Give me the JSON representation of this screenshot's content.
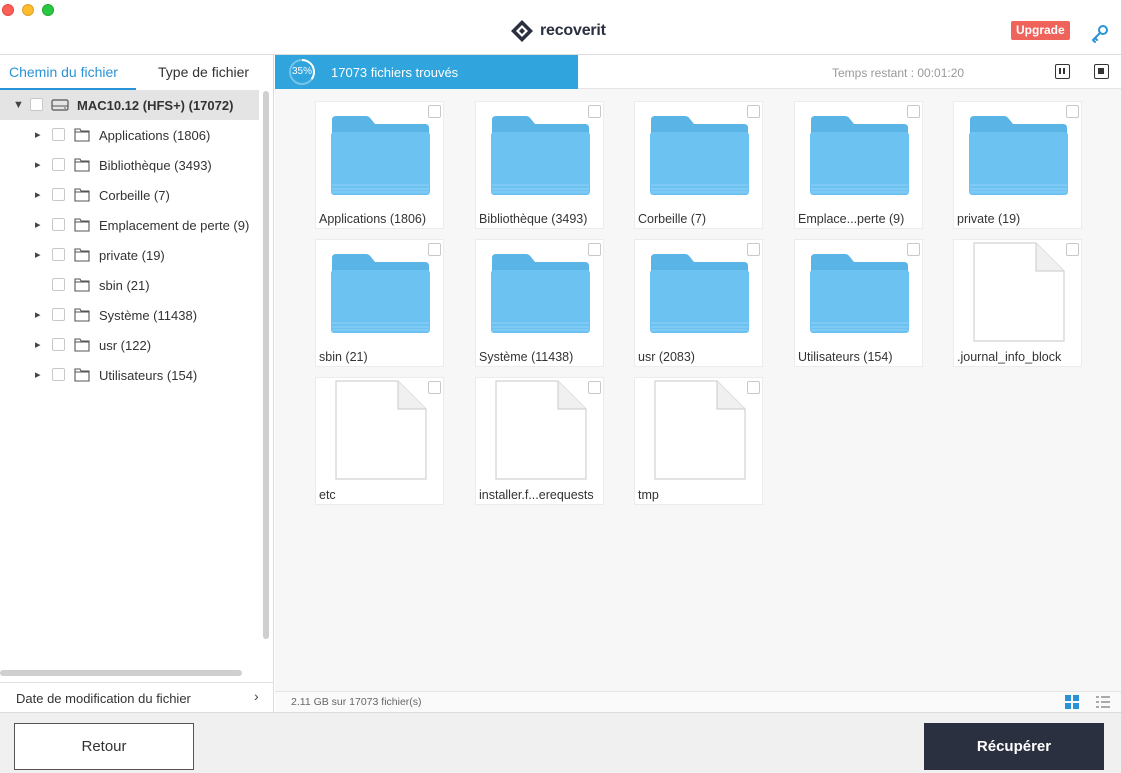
{
  "app": {
    "name_part1": "recover",
    "name_part2": "it",
    "upgrade_label": "Upgrade"
  },
  "sidebar": {
    "tabs": [
      {
        "label": "Chemin du fichier",
        "active": true
      },
      {
        "label": "Type de fichier",
        "active": false
      }
    ],
    "root": {
      "label": "MAC10.12 (HFS+) (17072)",
      "expanded": true
    },
    "items": [
      {
        "label": "Applications (1806)",
        "expandable": true
      },
      {
        "label": "Bibliothèque (3493)",
        "expandable": true
      },
      {
        "label": "Corbeille (7)",
        "expandable": true
      },
      {
        "label": "Emplacement de perte (9)",
        "expandable": true
      },
      {
        "label": "private (19)",
        "expandable": true
      },
      {
        "label": "sbin (21)",
        "expandable": false
      },
      {
        "label": "Système (11438)",
        "expandable": true
      },
      {
        "label": "usr (122)",
        "expandable": true
      },
      {
        "label": "Utilisateurs (154)",
        "expandable": true
      }
    ],
    "filter_label": "Date de modification du fichier"
  },
  "scan": {
    "progress_percent": 35,
    "progress_label": "35%",
    "found_label": "17073 fichiers trouvés",
    "remaining_label": "Temps restant : 00:01:20"
  },
  "files": [
    {
      "name": "Applications (1806)",
      "kind": "folder"
    },
    {
      "name": "Bibliothèque (3493)",
      "kind": "folder"
    },
    {
      "name": "Corbeille (7)",
      "kind": "folder"
    },
    {
      "name": "Emplace...perte (9)",
      "kind": "folder"
    },
    {
      "name": "private (19)",
      "kind": "folder"
    },
    {
      "name": "sbin (21)",
      "kind": "folder"
    },
    {
      "name": "Système (11438)",
      "kind": "folder"
    },
    {
      "name": "usr (2083)",
      "kind": "folder"
    },
    {
      "name": "Utilisateurs (154)",
      "kind": "folder"
    },
    {
      "name": ".journal_info_block",
      "kind": "file"
    },
    {
      "name": "etc",
      "kind": "file"
    },
    {
      "name": "installer.f...erequests",
      "kind": "file"
    },
    {
      "name": "tmp",
      "kind": "file"
    }
  ],
  "status": {
    "summary": "2.11 GB sur 17073 fichier(s)"
  },
  "actions": {
    "back_label": "Retour",
    "recover_label": "Récupérer"
  },
  "colors": {
    "accent": "#2fa4dd",
    "tab_active": "#2a92d6",
    "upgrade": "#f0635b",
    "primary_button": "#2b3040",
    "folder": "#6cc3f2"
  }
}
